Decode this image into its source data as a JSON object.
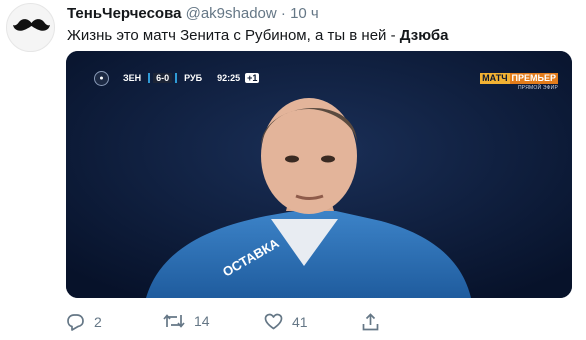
{
  "tweet": {
    "author_name": "ТеньЧерчесова",
    "handle": "@ak9shadow",
    "separator": "·",
    "time": "10 ч",
    "text_main": "Жизнь это матч Зенита с Рубином, а ты в ней - ",
    "text_bold": "Дзюба"
  },
  "media": {
    "scoreboard": {
      "home_team": "ЗЕН",
      "score": "6-0",
      "away_team": "РУБ",
      "clock": "92:25",
      "added_time": "+1"
    },
    "broadcaster": {
      "logo_left": "МАТЧ",
      "logo_right": "ПРЕМЬЕР",
      "subtitle": "ПРЯМОЙ ЭФИР"
    }
  },
  "actions": {
    "replies": "2",
    "retweets": "14",
    "likes": "41"
  },
  "colors": {
    "text_primary": "#14171a",
    "text_secondary": "#657786",
    "media_background": "#0b1830"
  }
}
